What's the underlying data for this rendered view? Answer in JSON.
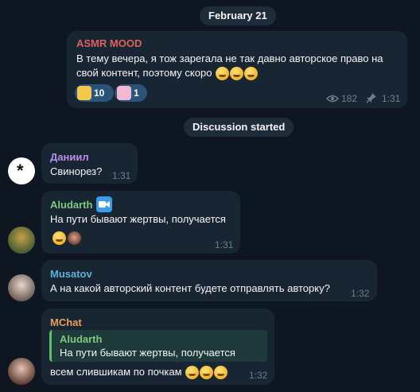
{
  "date_separator": "February 21",
  "channel_post": {
    "author": "ASMR MOOD",
    "line1": "В тему вечера, я тож зарегала не так давно авторское право на",
    "line2": "свой контент, поэтому скоро",
    "reactions": [
      {
        "icon": "party-face-icon",
        "count": "10"
      },
      {
        "icon": "cake-face-icon",
        "count": "1"
      }
    ],
    "views": "182",
    "time": "1:31"
  },
  "discussion_separator": "Discussion started",
  "messages": [
    {
      "author": "Даниил",
      "text": "Свинорез?",
      "time": "1:31"
    },
    {
      "author": "Aludarth",
      "text": "На пути бывают жертвы, получается",
      "time": "1:31"
    },
    {
      "author": "Musatov",
      "text": "А на какой авторский контент будете отправлять авторку?",
      "time": "1:32"
    },
    {
      "author": "MChat",
      "quote_author": "Aludarth",
      "quote_text": "На пути бывают жертвы, получается",
      "text": "всем слившикам по почкам",
      "time": "1:32"
    }
  ],
  "colors": {
    "background": "#0e1621",
    "bubble": "#182533",
    "asmr": "#e0605e",
    "daniil": "#b98ee8",
    "aludarth": "#7ec97f",
    "musatov": "#5fb0d8",
    "mchat": "#e8a056"
  }
}
